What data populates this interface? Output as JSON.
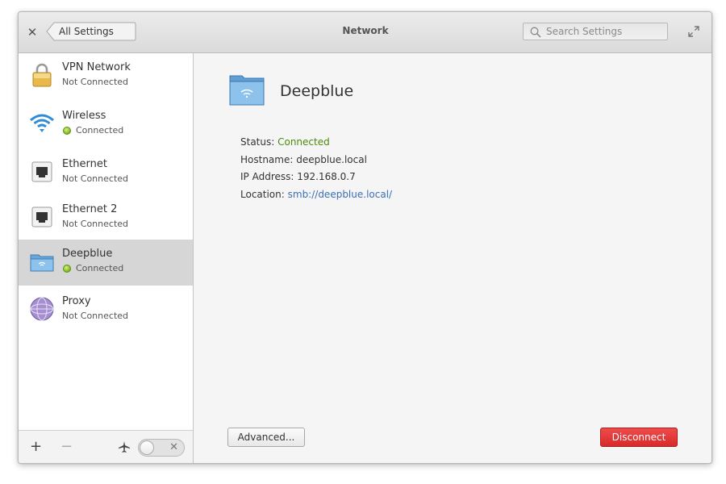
{
  "header": {
    "back_label": "All Settings",
    "title": "Network",
    "search_placeholder": "Search Settings"
  },
  "sidebar": {
    "items": [
      {
        "name": "VPN Network",
        "status": "Not Connected",
        "icon": "lock-icon"
      },
      {
        "name": "Wireless",
        "status": "Connected",
        "icon": "wifi-icon"
      },
      {
        "name": "Ethernet",
        "status": "Not Connected",
        "icon": "ethernet-icon"
      },
      {
        "name": "Ethernet 2",
        "status": "Not Connected",
        "icon": "ethernet-icon"
      },
      {
        "name": "Deepblue",
        "status": "Connected",
        "icon": "network-folder-icon"
      },
      {
        "name": "Proxy",
        "status": "Not Connected",
        "icon": "globe-icon"
      }
    ],
    "footer": {
      "add_label": "+",
      "remove_label": "−",
      "airplane_mode": false
    }
  },
  "main": {
    "title": "Deepblue",
    "status_label": "Status: ",
    "status_value": "Connected",
    "hostname_line": "Hostname: deepblue.local",
    "ip_line": "IP Address: 192.168.0.7",
    "location_label": "Location: ",
    "location_value": "smb://deepblue.local/",
    "advanced_label": "Advanced...",
    "disconnect_label": "Disconnect"
  },
  "colors": {
    "connected": "#4a8a0c",
    "link": "#3b6fb4",
    "danger": "#e23636",
    "selected": "#d6d6d6"
  }
}
